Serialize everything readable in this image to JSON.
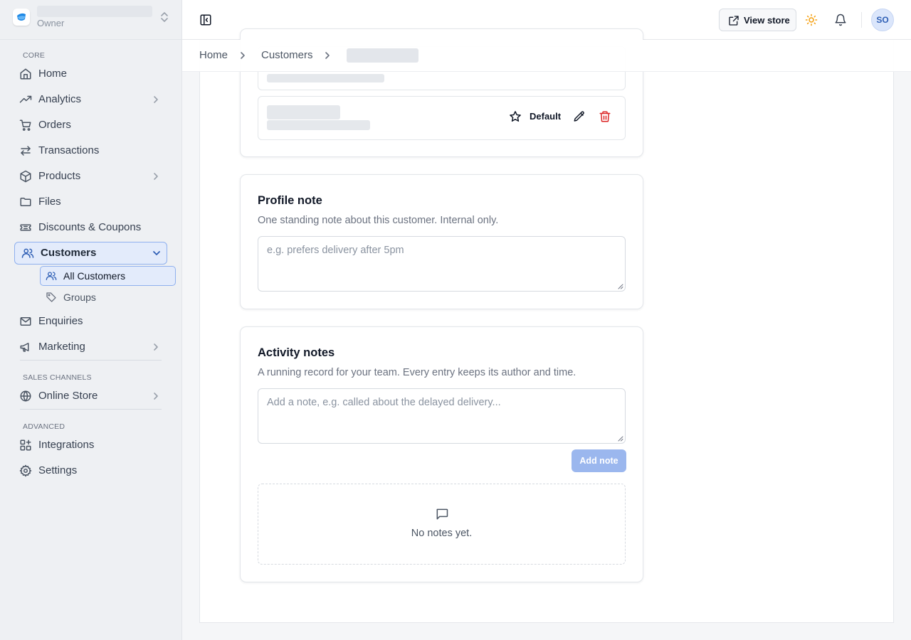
{
  "store": {
    "role": "Owner"
  },
  "sidebar": {
    "sections": {
      "core": "CORE",
      "sales_channels": "SALES CHANNELS",
      "advanced": "ADVANCED"
    },
    "items": {
      "home": "Home",
      "analytics": "Analytics",
      "orders": "Orders",
      "transactions": "Transactions",
      "products": "Products",
      "files": "Files",
      "discounts": "Discounts & Coupons",
      "customers": "Customers",
      "all_customers": "All Customers",
      "groups": "Groups",
      "enquiries": "Enquiries",
      "marketing": "Marketing",
      "online_store": "Online Store",
      "integrations": "Integrations",
      "settings": "Settings"
    }
  },
  "topbar": {
    "view_store_label": "View store",
    "avatar_initials": "SO"
  },
  "breadcrumb": {
    "home": "Home",
    "customers": "Customers"
  },
  "addresses": {
    "default_label": "Default"
  },
  "profile_note": {
    "title": "Profile note",
    "description": "One standing note about this customer. Internal only.",
    "placeholder": "e.g. prefers delivery after 5pm"
  },
  "activity_notes": {
    "title": "Activity notes",
    "description": "A running record for your team. Every entry keeps its author and time.",
    "placeholder": "Add a note, e.g. called about the delayed delivery...",
    "add_button": "Add note",
    "empty_text": "No notes yet."
  },
  "colors": {
    "accent": "#2f5fb5",
    "active_bg": "#e3ebfb",
    "active_border": "#8fb0ee",
    "delete": "#dc2626",
    "sun": "#f59e0b",
    "add_button_disabled": "#9bb7ee"
  },
  "icons": {
    "store_logo": "store-logo-icon",
    "home": "home-icon",
    "analytics": "trending-up-icon",
    "orders": "cart-icon",
    "transactions": "arrows-exchange-icon",
    "products": "box-icon",
    "files": "folder-icon",
    "discounts": "ticket-icon",
    "customers": "users-icon",
    "groups": "tag-icon",
    "enquiries": "mail-icon",
    "marketing": "megaphone-icon",
    "online_store": "globe-icon",
    "integrations": "grid-plus-icon",
    "settings": "gear-icon",
    "theme": "sun-icon",
    "notifications": "bell-icon",
    "default": "star-icon",
    "edit": "pencil-icon",
    "delete": "trash-icon",
    "empty_notes": "message-square-icon"
  }
}
